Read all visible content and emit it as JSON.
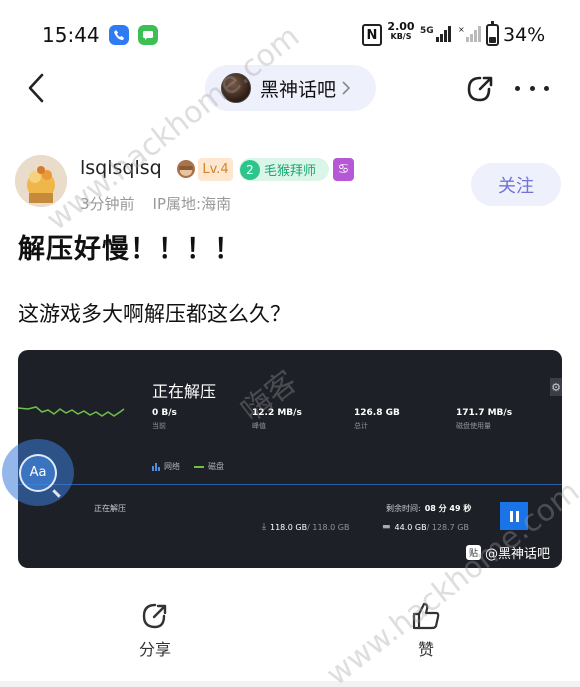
{
  "status_bar": {
    "time": "15:44",
    "net_speed_value": "2.00",
    "net_speed_unit": "KB/S",
    "network_type": "5G",
    "battery": "34%",
    "battery_level": 0.34
  },
  "header": {
    "forum_name": "黑神话吧"
  },
  "post": {
    "username": "lsqlsqlsq",
    "user_level": "Lv.4",
    "forum_level_num": "2",
    "forum_level_title": "毛猴拜师",
    "zodiac": "♋",
    "time_ago": "3分钟前",
    "ip_location": "IP属地:海南",
    "follow_label": "关注",
    "title": "解压好慢！！！！",
    "body": "这游戏多大啊解压都这么久？"
  },
  "screenshot": {
    "heading": "正在解压",
    "stats": [
      {
        "value": "0 B/s",
        "label": "当前"
      },
      {
        "value": "12.2 MB/s",
        "label": "峰值"
      },
      {
        "value": "126.8 GB",
        "label": "总计"
      },
      {
        "value": "171.7 MB/s",
        "label": "磁盘使用量"
      }
    ],
    "legend_network": "网络",
    "legend_disk": "磁盘",
    "status": "正在解压",
    "remaining_label": "剩余时间:",
    "remaining_value": "08 分 49 秒",
    "download_done": "118.0 GB",
    "download_total": " / 118.0 GB",
    "disk_done": "44.0 GB",
    "disk_total": " / 128.7 GB",
    "watermark_tag": "@黑神话吧"
  },
  "float_bubble": {
    "label": "Aa"
  },
  "actions": {
    "share": "分享",
    "like": "赞"
  },
  "watermarks": {
    "site": "www.hackhome.com",
    "cn": "嗨客"
  },
  "colors": {
    "accent": "#6f72d8",
    "pill_bg": "#eef0fb",
    "level_green": "#2cc58a",
    "zodiac_purple": "#b658d6",
    "lv_orange": "#d9822b",
    "pause_blue": "#1a74e8"
  }
}
